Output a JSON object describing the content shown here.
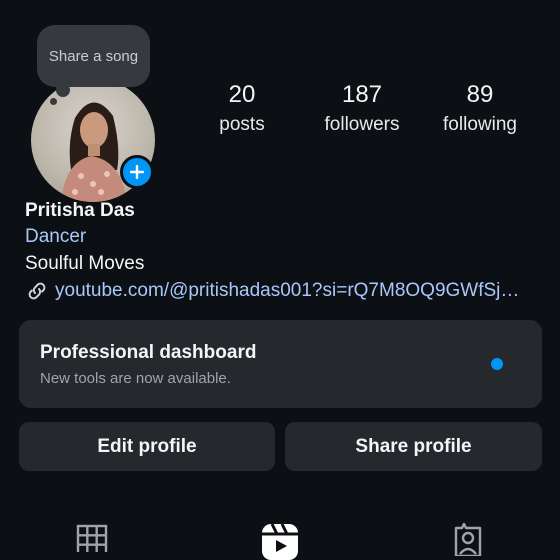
{
  "note": {
    "text": "Share a song"
  },
  "stats": {
    "posts": {
      "count": "20",
      "label": "posts"
    },
    "followers": {
      "count": "187",
      "label": "followers"
    },
    "following": {
      "count": "89",
      "label": "following"
    }
  },
  "profile": {
    "name": "Pritisha Das",
    "category": "Dancer",
    "bio": "Soulful Moves",
    "link": "youtube.com/@pritishadas001?si=rQ7M8OQ9GWfSj…"
  },
  "dashboard": {
    "title": "Professional dashboard",
    "subtitle": "New tools are now available."
  },
  "buttons": {
    "edit": "Edit profile",
    "share": "Share profile"
  },
  "tabs": [
    {
      "icon": "grid-icon"
    },
    {
      "icon": "reels-icon"
    },
    {
      "icon": "tagged-icon"
    }
  ],
  "colors": {
    "background": "#0c1014",
    "card": "#25292e",
    "accent": "#0095f6",
    "link": "#a8c7fa"
  }
}
